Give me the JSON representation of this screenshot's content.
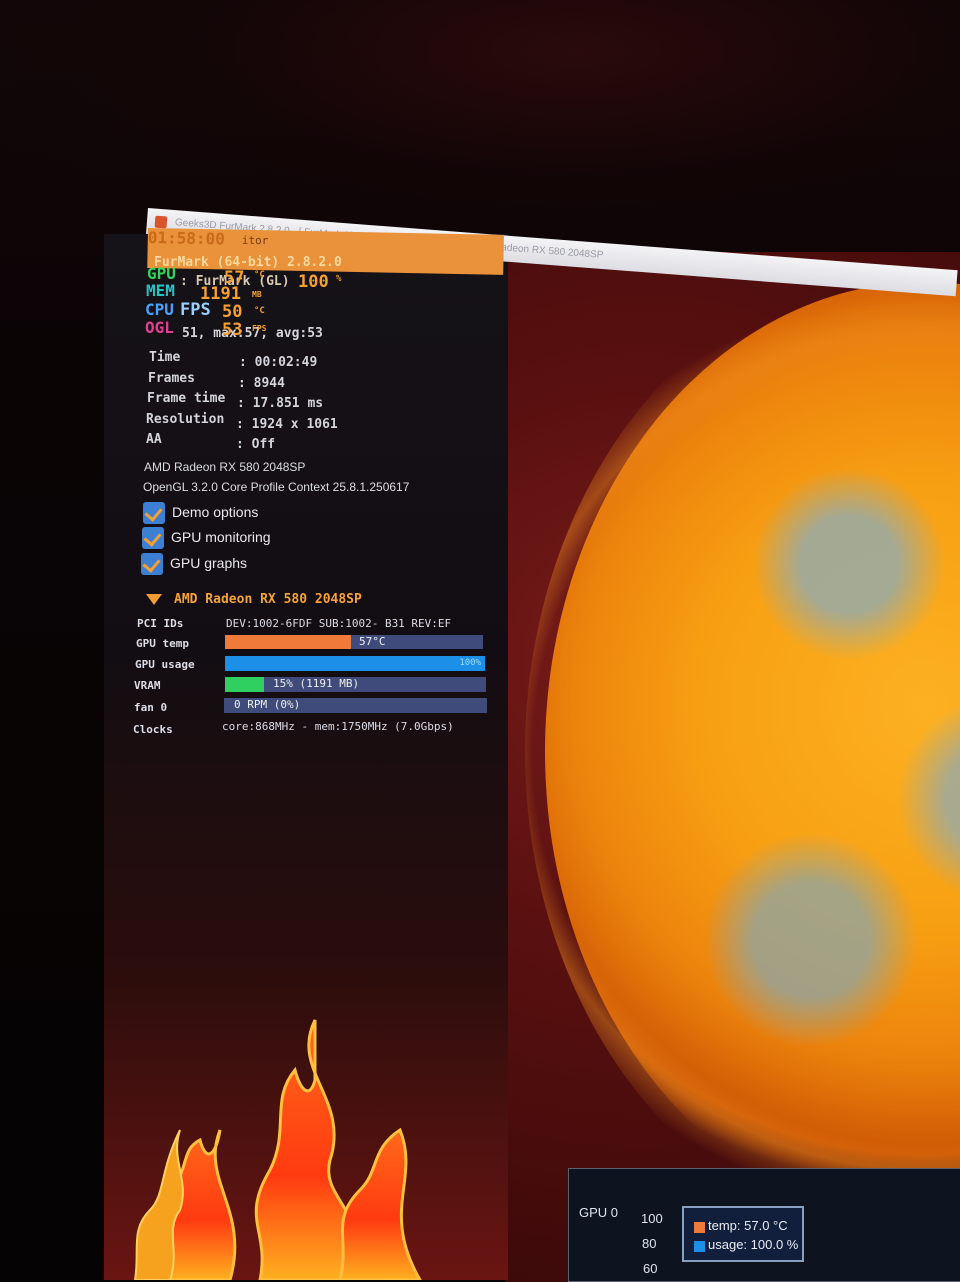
{
  "window": {
    "title": "Geeks3D FurMark 2.8.2.0 - [ FurMark (GL) ] - 53 FPS, 19.404ms - AMD Radeon RX 580 2048SP"
  },
  "hud": {
    "top_bar_text": "01:58:00",
    "top_bar_suffix": "itor",
    "header_line1": "FurMark (64-bit) 2.8.2.0",
    "header_line2": ": FurMark (GL)",
    "header_line3": "51, max:57, avg:53",
    "gpu_tag": "GPU",
    "gpu_temp": "57",
    "gpu_temp_unit": "°C",
    "gpu_usage": "100",
    "gpu_usage_unit": "%",
    "mem_tag": "MEM",
    "mem_value": "1191",
    "mem_unit": "MB",
    "cpu_tag": "CPU",
    "cpu_value": "50",
    "cpu_unit": "°C",
    "fps_label": "FPS",
    "ogl_tag": "OGL",
    "fps_value": "53",
    "fps_unit": "FPS",
    "stats": [
      {
        "label": "Time",
        "value": ": 00:02:49"
      },
      {
        "label": "Frames",
        "value": ": 8944"
      },
      {
        "label": "Frame time",
        "value": ": 17.851 ms"
      },
      {
        "label": "Resolution",
        "value": ": 1924 x 1061"
      },
      {
        "label": "AA",
        "value": ": Off"
      }
    ],
    "gpu_name": "AMD Radeon RX 580 2048SP",
    "opengl": "OpenGL 3.2.0 Core Profile Context 25.8.1.250617"
  },
  "options": [
    {
      "label": "Demo options",
      "checked": true
    },
    {
      "label": "GPU monitoring",
      "checked": true
    },
    {
      "label": "GPU graphs",
      "checked": true
    }
  ],
  "gpu_section": {
    "title": "AMD Radeon RX 580 2048SP",
    "pci_label": "PCI IDs",
    "pci_value": "DEV:1002-6FDF SUB:1002- B31 REV:EF",
    "temp_label": "GPU temp",
    "temp_text": "57°C",
    "temp_fraction": 0.49,
    "usage_label": "GPU usage",
    "usage_text": "100%",
    "usage_fraction": 1.0,
    "vram_label": "VRAM",
    "vram_text": "15% (1191 MB)",
    "vram_fraction": 0.15,
    "fan_label": "fan 0",
    "fan_text": "0 RPM (0%)",
    "fan_fraction": 0.0,
    "clocks_label": "Clocks",
    "clocks_value": "core:868MHz - mem:1750MHz (7.0Gbps)"
  },
  "graph": {
    "title": "GPU 0",
    "ticks": [
      "100",
      "80",
      "60"
    ],
    "legend_temp": "temp: 57.0 °C",
    "legend_usage": "usage: 100.0 %"
  },
  "colors": {
    "accent_orange": "#f39a30",
    "temp_fill": "#f07a3a",
    "usage_fill": "#1c8fe8",
    "vram_fill": "#2fd060",
    "bar_bg": "#3f4b7a",
    "checkbox": "#3d7fd3"
  }
}
